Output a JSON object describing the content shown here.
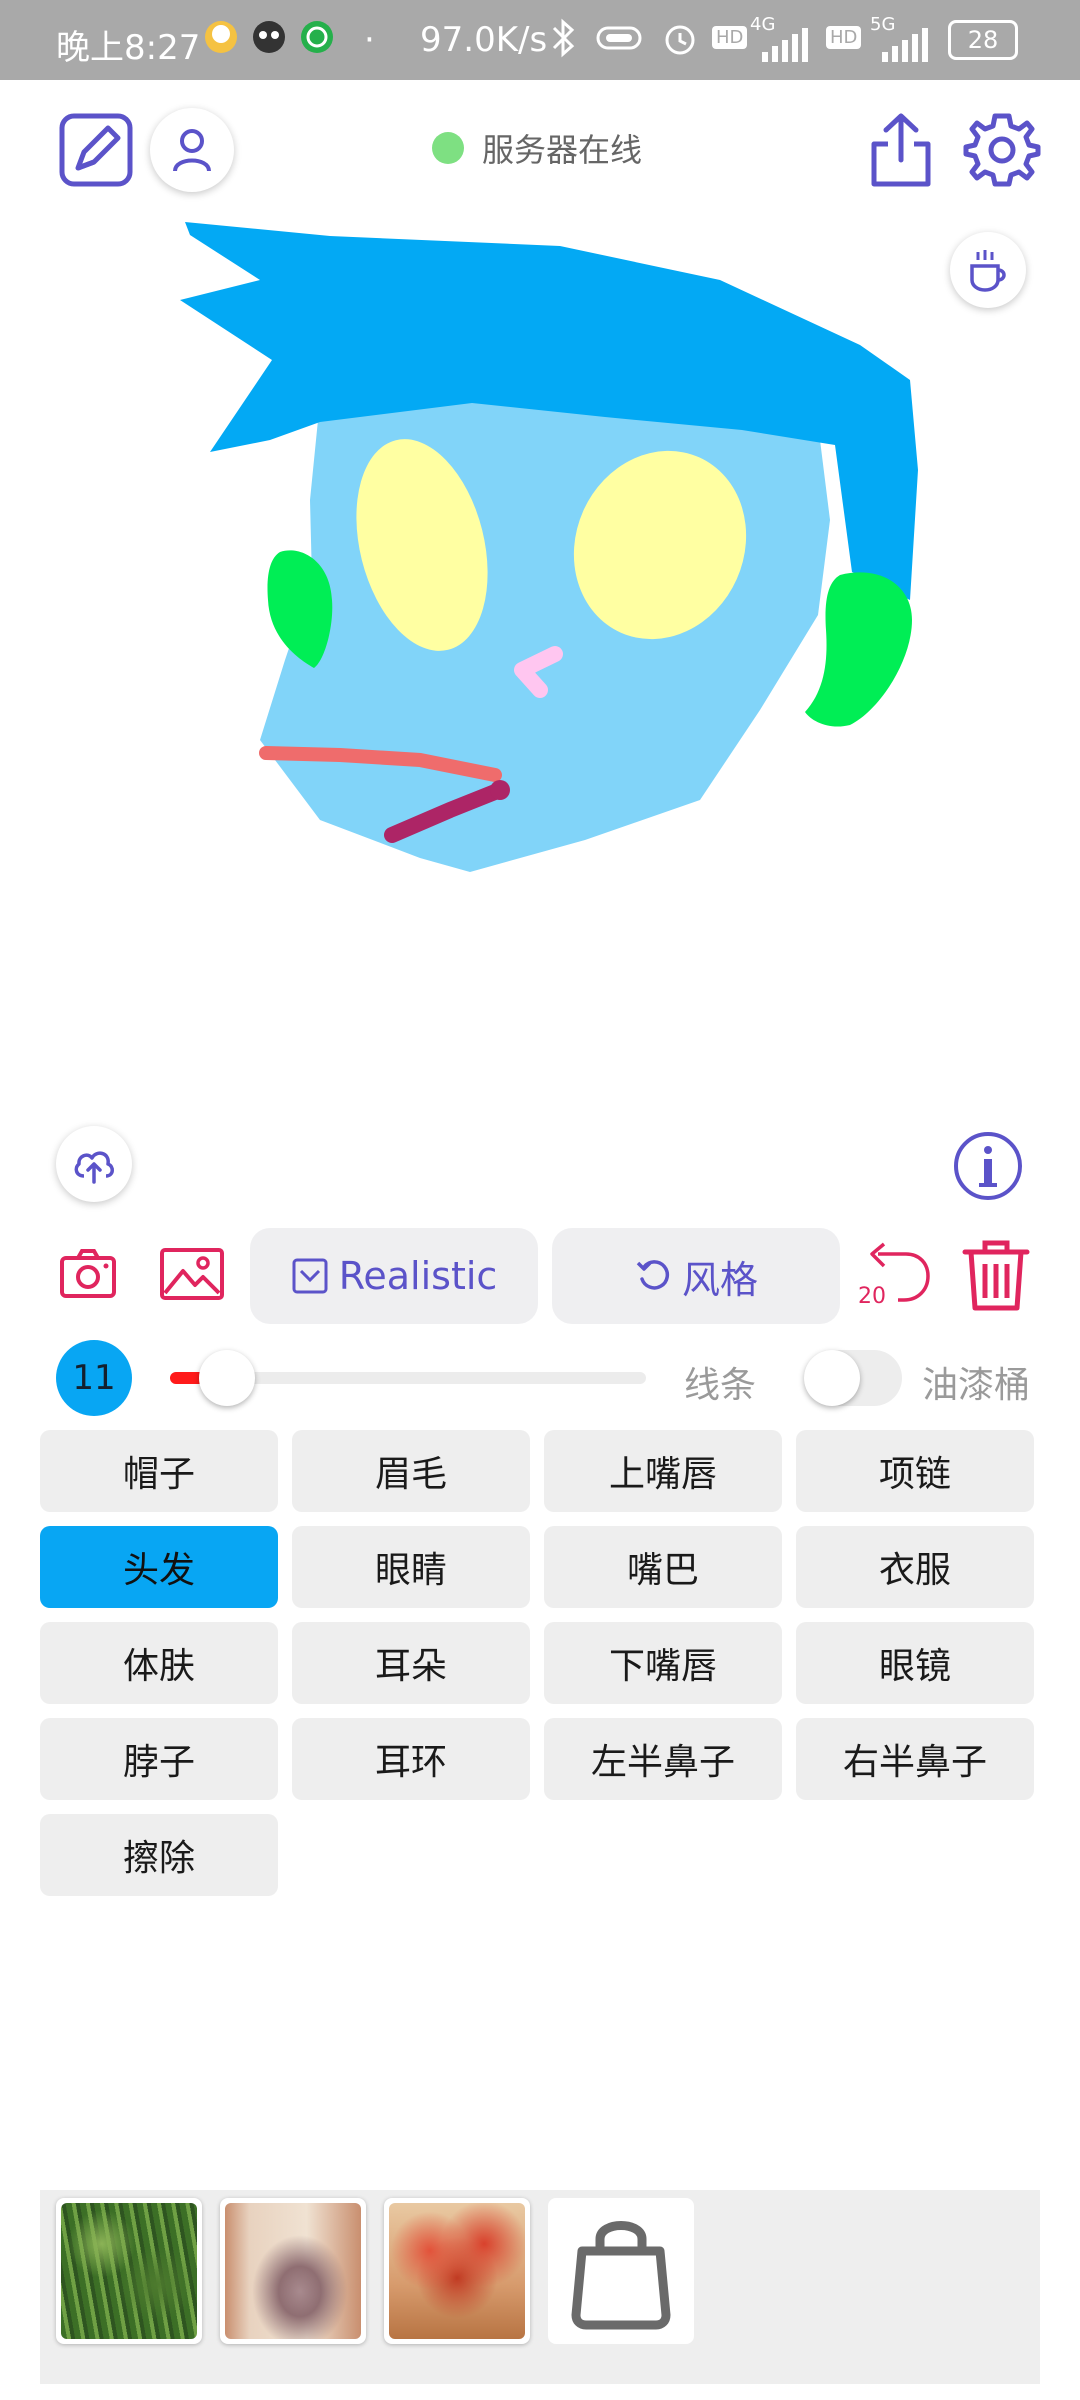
{
  "status_bar": {
    "time": "晚上8:27",
    "speed": "97.0K/s",
    "battery": "28",
    "icons": [
      "qq-icon",
      "app-icon",
      "whatsapp-icon",
      "bluetooth-icon",
      "vibrate-icon",
      "alarm-icon",
      "hd-icon",
      "4g-signal-icon",
      "5g-signal-icon",
      "battery-icon"
    ],
    "signal_4g": "4G",
    "signal_5g": "5G",
    "hd": "HD"
  },
  "header": {
    "server_status": "服务器在线",
    "server_status_color": "#7ee082",
    "icons": [
      "edit-icon",
      "user-icon",
      "share-icon",
      "settings-icon",
      "coffee-icon"
    ]
  },
  "toolbar": {
    "model_label": "Realistic",
    "style_label": "风格",
    "undo_count": "20",
    "accent": "#e0255e",
    "brand": "#5b53c9"
  },
  "brush": {
    "size": "11",
    "slider_fraction": 0.12,
    "line_label": "线条",
    "bucket_label": "油漆桶",
    "bucket_on": false
  },
  "parts": {
    "items": [
      {
        "label": "帽子"
      },
      {
        "label": "眉毛"
      },
      {
        "label": "上嘴唇"
      },
      {
        "label": "项链"
      },
      {
        "label": "头发"
      },
      {
        "label": "眼睛"
      },
      {
        "label": "嘴巴"
      },
      {
        "label": "衣服"
      },
      {
        "label": "体肤"
      },
      {
        "label": "耳朵"
      },
      {
        "label": "下嘴唇"
      },
      {
        "label": "眼镜"
      },
      {
        "label": "脖子"
      },
      {
        "label": "耳环"
      },
      {
        "label": "左半鼻子"
      },
      {
        "label": "右半鼻子"
      },
      {
        "label": "擦除"
      }
    ],
    "selected": "头发",
    "selected_color": "#08a6f3"
  },
  "gallery": {
    "items": [
      "thumbnail-grass",
      "thumbnail-portrait",
      "thumbnail-red-tree"
    ],
    "bag_icon": "shopping-bag-icon"
  }
}
